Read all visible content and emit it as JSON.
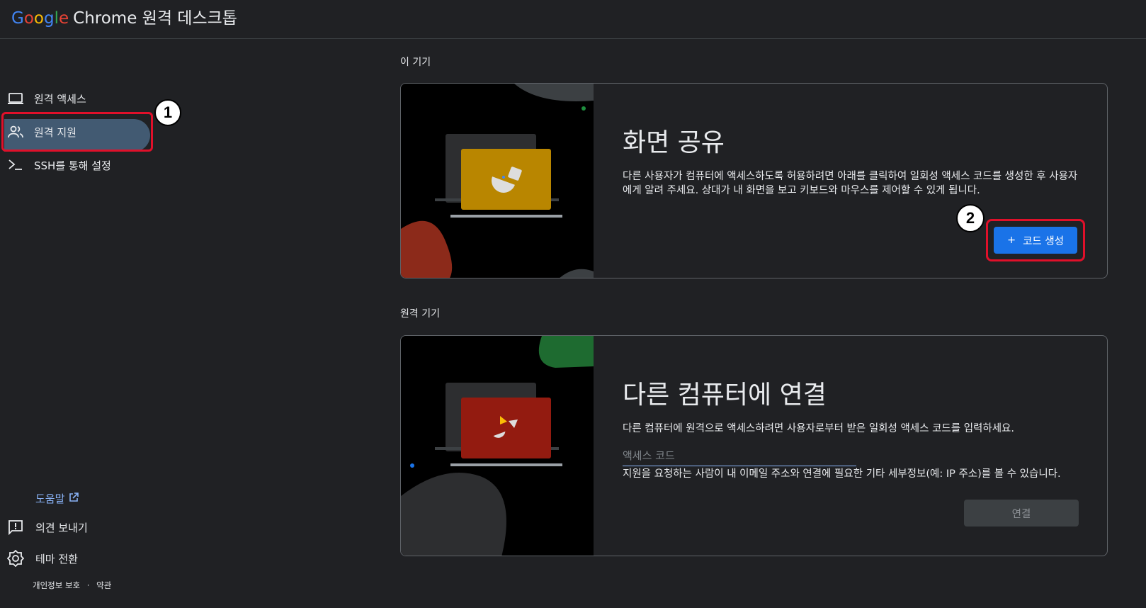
{
  "header": {
    "brand_google_letters": [
      "G",
      "o",
      "o",
      "g",
      "l",
      "e"
    ],
    "brand_rest": "Chrome 원격 데스크톱"
  },
  "sidebar": {
    "items": [
      {
        "label": "원격 액세스",
        "icon": "laptop-icon"
      },
      {
        "label": "원격 지원",
        "icon": "people-icon",
        "active": true
      },
      {
        "label": "SSH를 통해 설정",
        "icon": "terminal-icon"
      }
    ],
    "help_label": "도움말",
    "feedback_label": "의견 보내기",
    "theme_label": "테마 전환",
    "privacy_label": "개인정보 보호",
    "legal_separator": "·",
    "terms_label": "약관"
  },
  "annotations": {
    "badge1": "1",
    "badge2": "2"
  },
  "this_device": {
    "section_title": "이 기기",
    "card_title": "화면 공유",
    "description": "다른 사용자가 컴퓨터에 액세스하도록 허용하려면 아래를 클릭하여 일회성 액세스 코드를 생성한 후 사용자에게 알려 주세요. 상대가 내 화면을 보고 키보드와 마우스를 제어할 수 있게 됩니다.",
    "button_icon": "+",
    "button_label": "코드 생성"
  },
  "remote_device": {
    "section_title": "원격 기기",
    "card_title": "다른 컴퓨터에 연결",
    "description": "다른 컴퓨터에 원격으로 액세스하려면 사용자로부터 받은 일회성 액세스 코드를 입력하세요.",
    "input_placeholder": "액세스 코드",
    "input_value": "",
    "notice": "지원을 요청하는 사람이 내 이메일 주소와 연결에 필요한 기타 세부정보(예: IP 주소)를 볼 수 있습니다.",
    "connect_label": "연결"
  },
  "colors": {
    "background": "#202124",
    "accent_blue": "#1a73e8",
    "active_nav": "#425a72",
    "annotation_red": "#e0102a",
    "link_blue": "#8ab4f8"
  }
}
